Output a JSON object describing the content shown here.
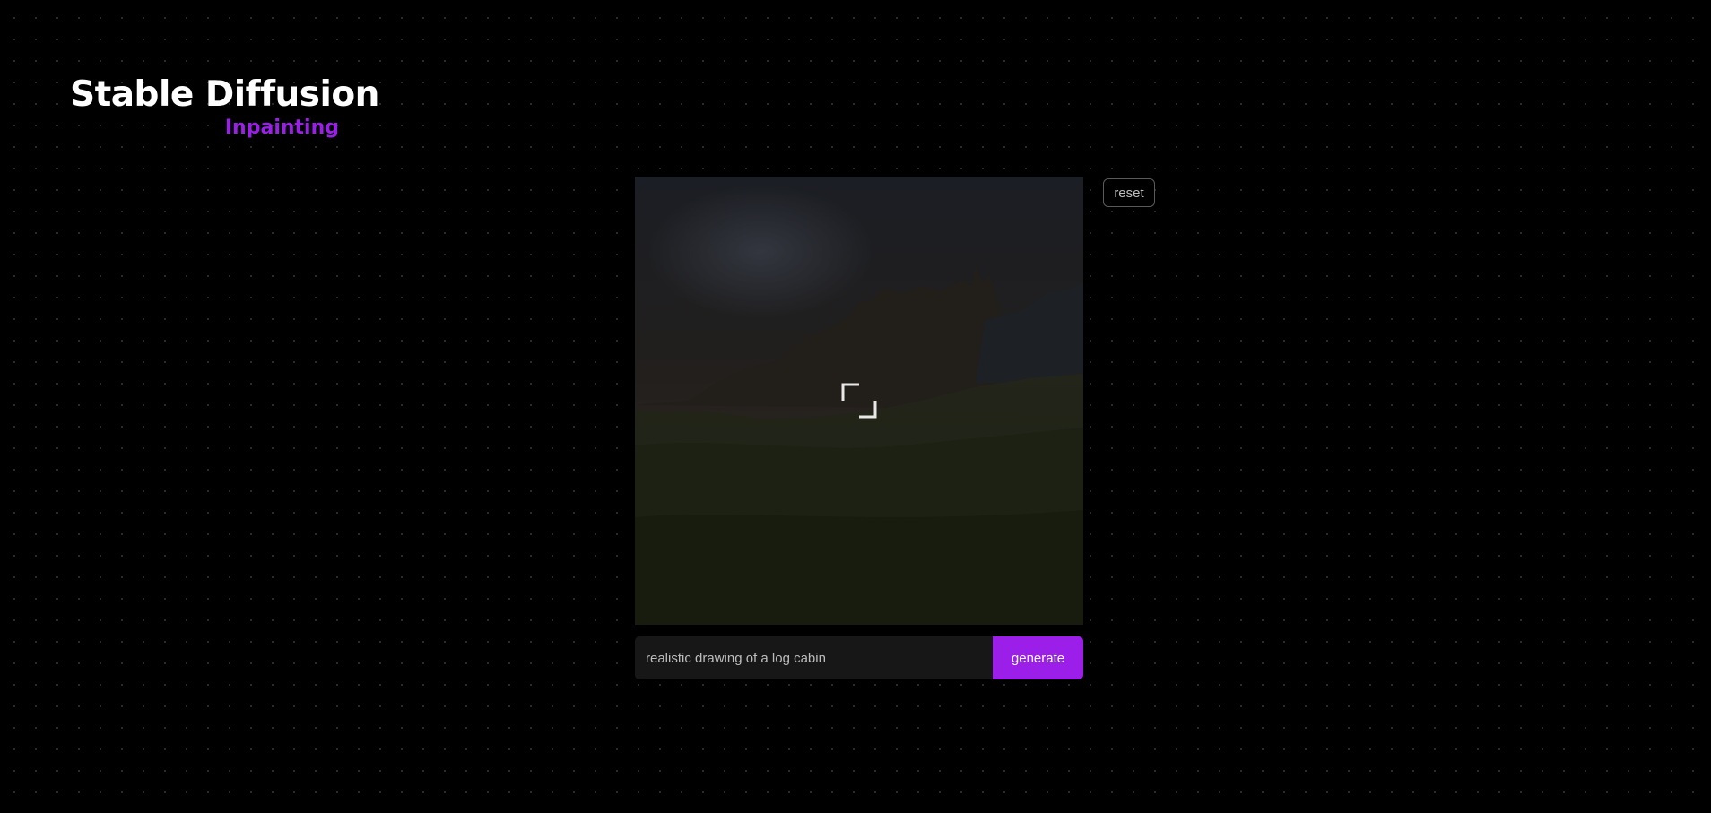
{
  "brand": {
    "title": "Stable Diffusion",
    "subtitle": "Inpainting"
  },
  "colors": {
    "accent": "#9b1fe8",
    "background": "#000000",
    "input_bg": "#171717"
  },
  "canvas": {
    "cursor_icon": "crosshair-icon"
  },
  "controls": {
    "reset_label": "reset",
    "prompt_value": "realistic drawing of a log cabin",
    "generate_label": "generate"
  }
}
